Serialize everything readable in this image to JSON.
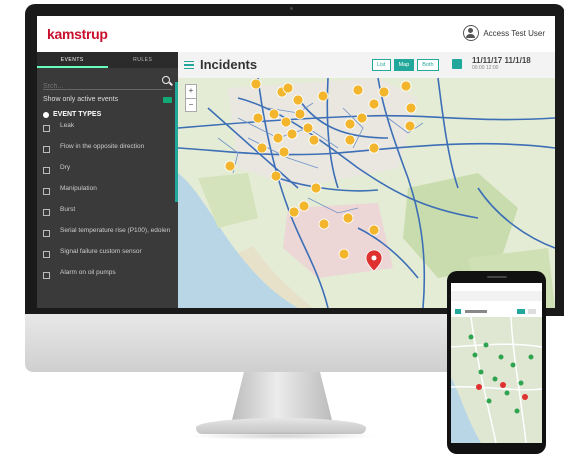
{
  "app": {
    "logo": "kamstrup",
    "user_name": "Access Test User"
  },
  "sidebar": {
    "tabs": [
      "EVENTS",
      "RULES"
    ],
    "search_placeholder": "Srch...",
    "only_active_label": "Show only active events",
    "section_title": "EVENT TYPES",
    "events": [
      "Leak",
      "Flow in the opposite direction",
      "Dry",
      "Manipulation",
      "Burst",
      "Serial temperature rise (P100), edolen",
      "Signal failure custom sensor",
      "Alarm on oil pumps"
    ]
  },
  "header": {
    "title": "Incidents",
    "view_buttons": [
      "List",
      "Map",
      "Both"
    ],
    "date_range": "11/11/17 11/1/18",
    "time_range": "00:00      12:00"
  },
  "map": {
    "zoom_in": "+",
    "zoom_out": "−"
  },
  "colors": {
    "brand": "#c8102e",
    "accent": "#22a89a",
    "marker": "#f2b52b",
    "selected_marker": "#e03131",
    "road": "#3d6fb6"
  }
}
